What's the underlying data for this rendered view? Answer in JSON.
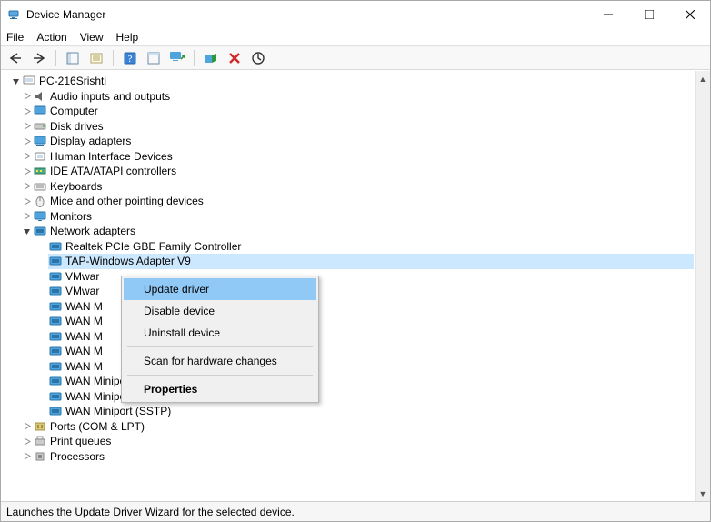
{
  "window": {
    "title": "Device Manager"
  },
  "menu": {
    "file": "File",
    "action": "Action",
    "view": "View",
    "help": "Help"
  },
  "tree": {
    "root": "PC-216Srishti",
    "categories": [
      {
        "label": "Audio inputs and outputs"
      },
      {
        "label": "Computer"
      },
      {
        "label": "Disk drives"
      },
      {
        "label": "Display adapters"
      },
      {
        "label": "Human Interface Devices"
      },
      {
        "label": "IDE ATA/ATAPI controllers"
      },
      {
        "label": "Keyboards"
      },
      {
        "label": "Mice and other pointing devices"
      },
      {
        "label": "Monitors"
      }
    ],
    "network_label": "Network adapters",
    "adapters": [
      "Realtek PCIe GBE Family Controller",
      "TAP-Windows Adapter V9",
      "VMwar",
      "VMwar",
      "WAN M",
      "WAN M",
      "WAN M",
      "WAN M",
      "WAN M",
      "WAN Miniport (PPPOE)",
      "WAN Miniport (PPTP)",
      "WAN Miniport (SSTP)"
    ],
    "after": [
      "Ports (COM & LPT)",
      "Print queues",
      "Processors"
    ]
  },
  "context_menu": {
    "update": "Update driver",
    "disable": "Disable device",
    "uninstall": "Uninstall device",
    "scan": "Scan for hardware changes",
    "properties": "Properties"
  },
  "status": "Launches the Update Driver Wizard for the selected device."
}
